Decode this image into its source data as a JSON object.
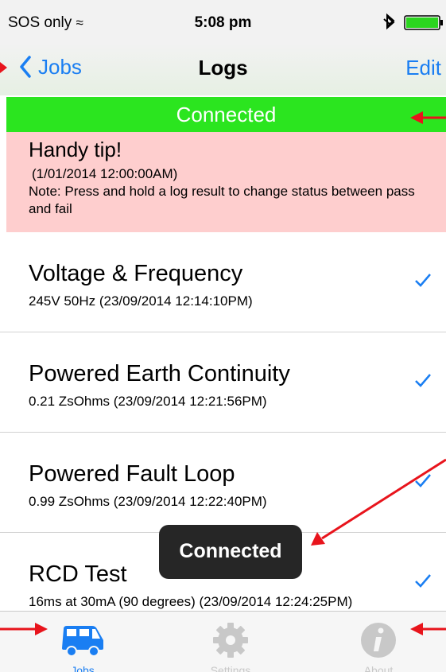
{
  "status_bar": {
    "carrier": "SOS only",
    "time": "5:08 pm"
  },
  "nav": {
    "back_label": "Jobs",
    "title": "Logs",
    "edit_label": "Edit"
  },
  "connection_banner": "Connected",
  "tip": {
    "title": "Handy tip!",
    "date": "(1/01/2014 12:00:00AM)",
    "note": "Note: Press and hold a log result to change status between pass and fail"
  },
  "logs": [
    {
      "title": "Voltage & Frequency",
      "detail": "245V 50Hz (23/09/2014 12:14:10PM)"
    },
    {
      "title": "Powered Earth Continuity",
      "detail": "0.21 ZsOhms (23/09/2014 12:21:56PM)"
    },
    {
      "title": "Powered Fault Loop",
      "detail": "0.99 ZsOhms (23/09/2014 12:22:40PM)"
    },
    {
      "title": "RCD Test",
      "detail": "16ms at 30mA (90 degrees) (23/09/2014 12:24:25PM)"
    }
  ],
  "toast": "Connected",
  "tabs": [
    {
      "label": "Jobs",
      "icon": "van-icon"
    },
    {
      "label": "Settings",
      "icon": "gear-icon"
    },
    {
      "label": "About",
      "icon": "info-icon"
    }
  ],
  "colors": {
    "accent": "#1a7ef2",
    "banner": "#2be51f",
    "tip_bg": "#fecece",
    "annotation": "#e8141c",
    "tab_inactive": "#c8c8c8"
  }
}
